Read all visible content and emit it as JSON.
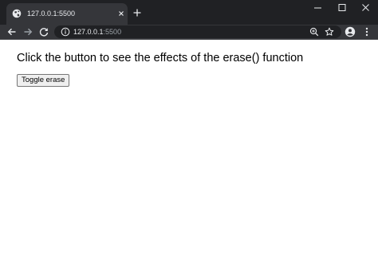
{
  "browser": {
    "tab": {
      "title": "127.0.0.1:5500",
      "favicon": "globe-icon",
      "close_icon": "close-icon"
    },
    "new_tab_icon": "plus-icon",
    "window_controls": [
      "minimize-icon",
      "maximize-icon",
      "close-icon"
    ],
    "toolbar": {
      "back_icon": "arrow-left-icon",
      "forward_icon": "arrow-right-icon",
      "reload_icon": "reload-icon",
      "site_info_icon": "info-icon",
      "address": {
        "host": "127.0.0.1",
        "port": ":5500"
      },
      "zoom_icon": "zoom-in-icon",
      "bookmark_icon": "star-icon",
      "profile_icon": "account-icon",
      "menu_icon": "kebab-menu-icon"
    },
    "colors": {
      "titlebar": "#202124",
      "toolbar": "#35363a",
      "omnibox": "#202124",
      "text_light": "#e8eaed",
      "text_dim": "#9aa0a6"
    }
  },
  "page": {
    "heading": "Click the button to see the effects of the erase() function",
    "button_label": "Toggle erase"
  }
}
